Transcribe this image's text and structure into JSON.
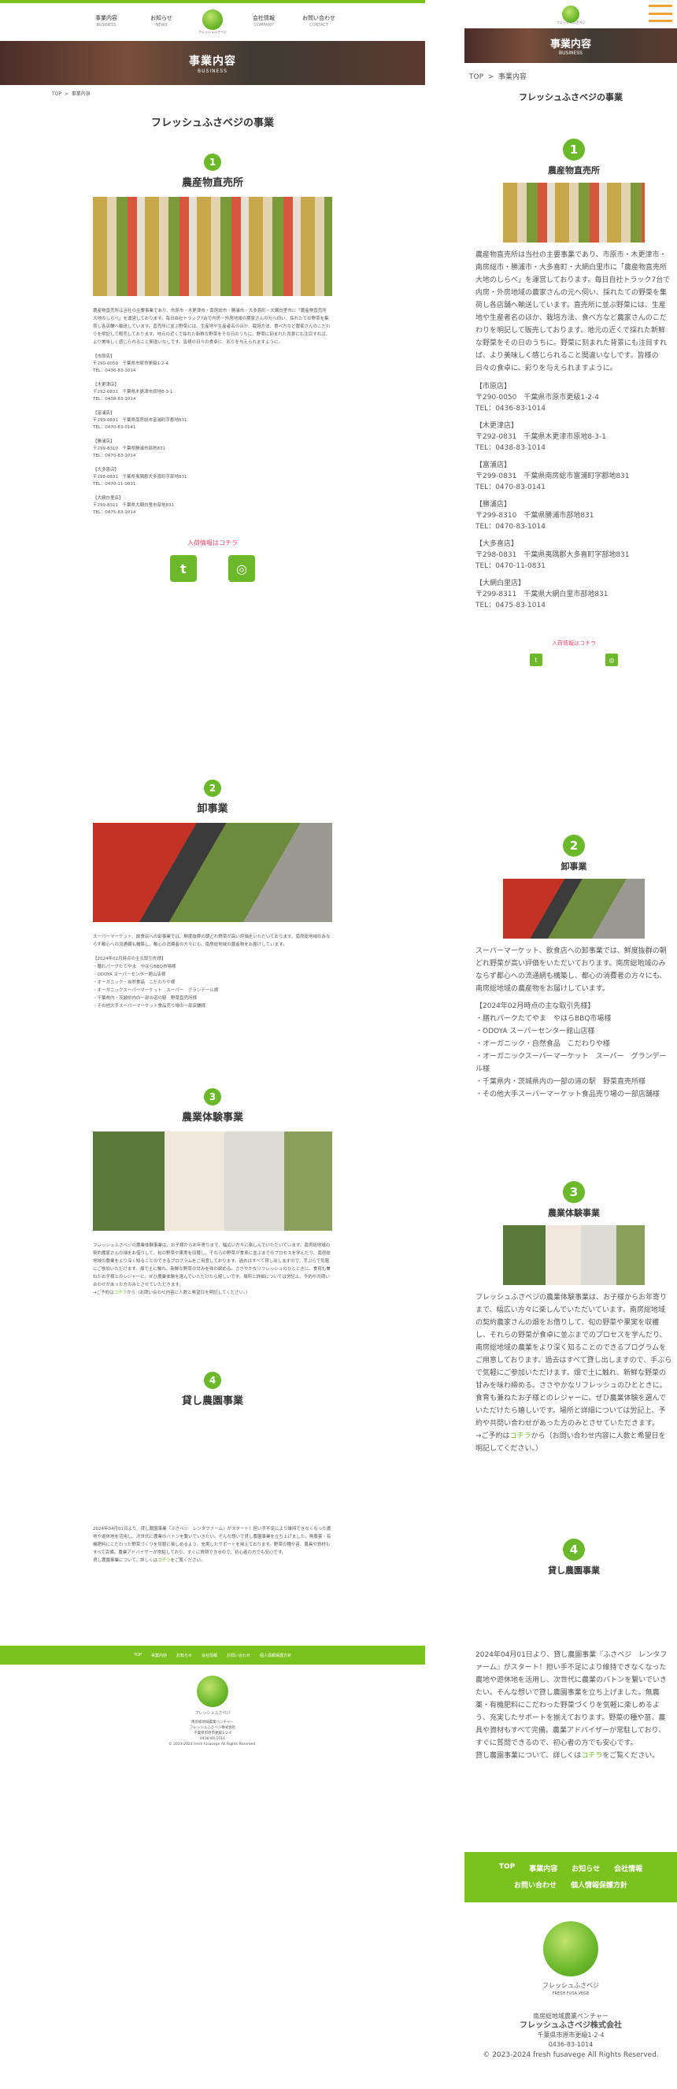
{
  "nav": {
    "business": {
      "label": "事業内容",
      "en": "BUSINESS"
    },
    "news": {
      "label": "お知らせ",
      "en": "NEWS"
    },
    "company": {
      "label": "会社情報",
      "en": "COMPANY"
    },
    "contact": {
      "label": "お問い合わせ",
      "en": "CONTACT"
    }
  },
  "logo": {
    "caption": "フレッシュふさベジ"
  },
  "hero": {
    "title": "事業内容",
    "subtitle": "BUSINESS"
  },
  "breadcrumb": {
    "top": "TOP",
    "sep": ">",
    "current": "事業内容"
  },
  "page_title": "フレッシュふさベジの事業",
  "sections": [
    {
      "number": "1",
      "heading": "農産物直売所",
      "text": "農産物直売所は当社の主要事業であり、市原市・木更津市・南房総市・勝浦市・大多喜町・大網白里市に「農産物直売所　大地のしらべ」を運営しております。毎日自社トラック7台で内房・外房地域の農家さんの元へ伺い、採れたての野菜を集荷し各店舗へ輸送しています。直売所に並ぶ野菜には、生産地や生産者名のほか、栽培方法、食べ方など農家さんのこだわりを明記して販売しております。地元の近くで採れた新鮮な野菜をその日のうちに。野菜に刻まれた背景にも注目すれば、より美味しく感じられること間違いなしです。皆様の日々の食卓に、彩りを与えられますように。",
      "stores": [
        {
          "name": "【市原店】",
          "address": "〒290-0050　千葉県市原市更級1-2-4",
          "tel": "TEL：0436-83-1014"
        },
        {
          "name": "【木更津店】",
          "address": "〒292-0831　千葉県木更津市原地8-3-1",
          "tel": "TEL：0438-83-1014"
        },
        {
          "name": "【富浦店】",
          "address": "〒299-0831　千葉県南房総市富浦町字郡地831",
          "tel": "TEL：0470-83-0141"
        },
        {
          "name": "【勝浦店】",
          "address": "〒299-8310　千葉県勝浦市部地831",
          "tel": "TEL：0470-83-1014"
        },
        {
          "name": "【大多喜店】",
          "address": "〒298-0831　千葉県夷隅郡大多喜町字部地831",
          "tel": "TEL：0470-11-0831"
        },
        {
          "name": "【大網白里店】",
          "address": "〒299-8311　千葉県大網白里市部地831",
          "tel": "TEL：0475-83-1014"
        }
      ],
      "link": "入荷情報はコチラ"
    },
    {
      "number": "2",
      "heading": "卸事業",
      "text": "スーパーマーケット、飲食店への卸事業では、鮮度抜群の朝どれ野菜が高い評価をいただいております。南房総地域のみならず都心への流通網も構築し、都心の消費者の方々にも、南房総地域の農産物をお届けしています。",
      "list_title": "【2024年02月時点の主な取引先様】",
      "list": [
        "・膳れパークたてやま　やはらBBQ市場様",
        "・ODOYA スーパーセンター館山店様",
        "・オーガニック・自然食品　こだわりや様",
        "・オーガニックスーパーマーケット　スーパー　グランデール様",
        "・千葉県内・茨城県内の一部の道の駅　野菜直売所様",
        "・その他大手スーパーマーケット食品売り場の一部店舗様"
      ]
    },
    {
      "number": "3",
      "heading": "農業体験事業",
      "text": "フレッシュふさベジの農業体験事業は、お子様からお年寄りまで、幅広い方々に楽しんでいただいています。南房総地域の契約農家さんの畑をお借りして、旬の野菜や果実を収穫し、それらの野菜が食卓に並ぶまでのプロセスを学んだり、南房総地域の農業をより深く知ることのできるプログラムをご用意しております。過去はすべて貸し出しますので、手ぶらで気軽にご参加いただけます。畑で土に触れ、新鮮な野菜の甘みを味わ締める。ささやかなリフレッシュのひとときに。食育も兼ねたお子様とのレジャーに。ぜひ農業体験を選んでいただけたら嬉しいです。場所と詳細については労記上、予約や共問い合わせがあった方のみとさせていただきます。",
      "link_prefix": "→ご予約は",
      "link": "コチラ",
      "link_suffix": "から（お問い合わせ内容に人数と希望日を明記してください。）"
    },
    {
      "number": "4",
      "heading": "貸し農園事業",
      "text": "2024年04月01日より、貸し農園事業『ふさベジ　レンタファーム』がスタート！担い手不足により維持できなくなった農地や遊休地を活用し、次世代に農業のバトンを繋いでいきたい。そんな想いで貸し農園事業を立ち上げました。無農薬・有機肥料にこだわった野菜づくりを気軽に楽しめるよう、充実したサポートを揃えております。野菜の種や苗、農具や資材もすべて完備。農業アドバイザーが常駐しており、すぐに質問できるので、初心者の方でも安心です。",
      "link_prefix": "貸し農園事業について、詳しくは",
      "link": "コチラ",
      "link_suffix": "をご覧ください。"
    }
  ],
  "social": {
    "twitter": "t",
    "instagram": "◎"
  },
  "footer_nav": [
    "TOP",
    "事業内容",
    "お知らせ",
    "会社情報",
    "お問い合わせ",
    "個人情報保護方針"
  ],
  "footer": {
    "logo_text": "フレッシュふさベジ",
    "logo_en": "FRESH FUSA VEGE",
    "tagline": "南房総地域農業ベンチャー",
    "company": "フレッシュふさベジ株式会社",
    "address": "千葉県市原市更級1-2-4",
    "tel": "0436-83-1014",
    "copyright": "© 2023-2024 fresh fusavege All Rights Reserved."
  },
  "colors": {
    "brand_green": "#6bb82b",
    "link_pink": "#e74a70",
    "menu_orange": "#f0a23a"
  }
}
